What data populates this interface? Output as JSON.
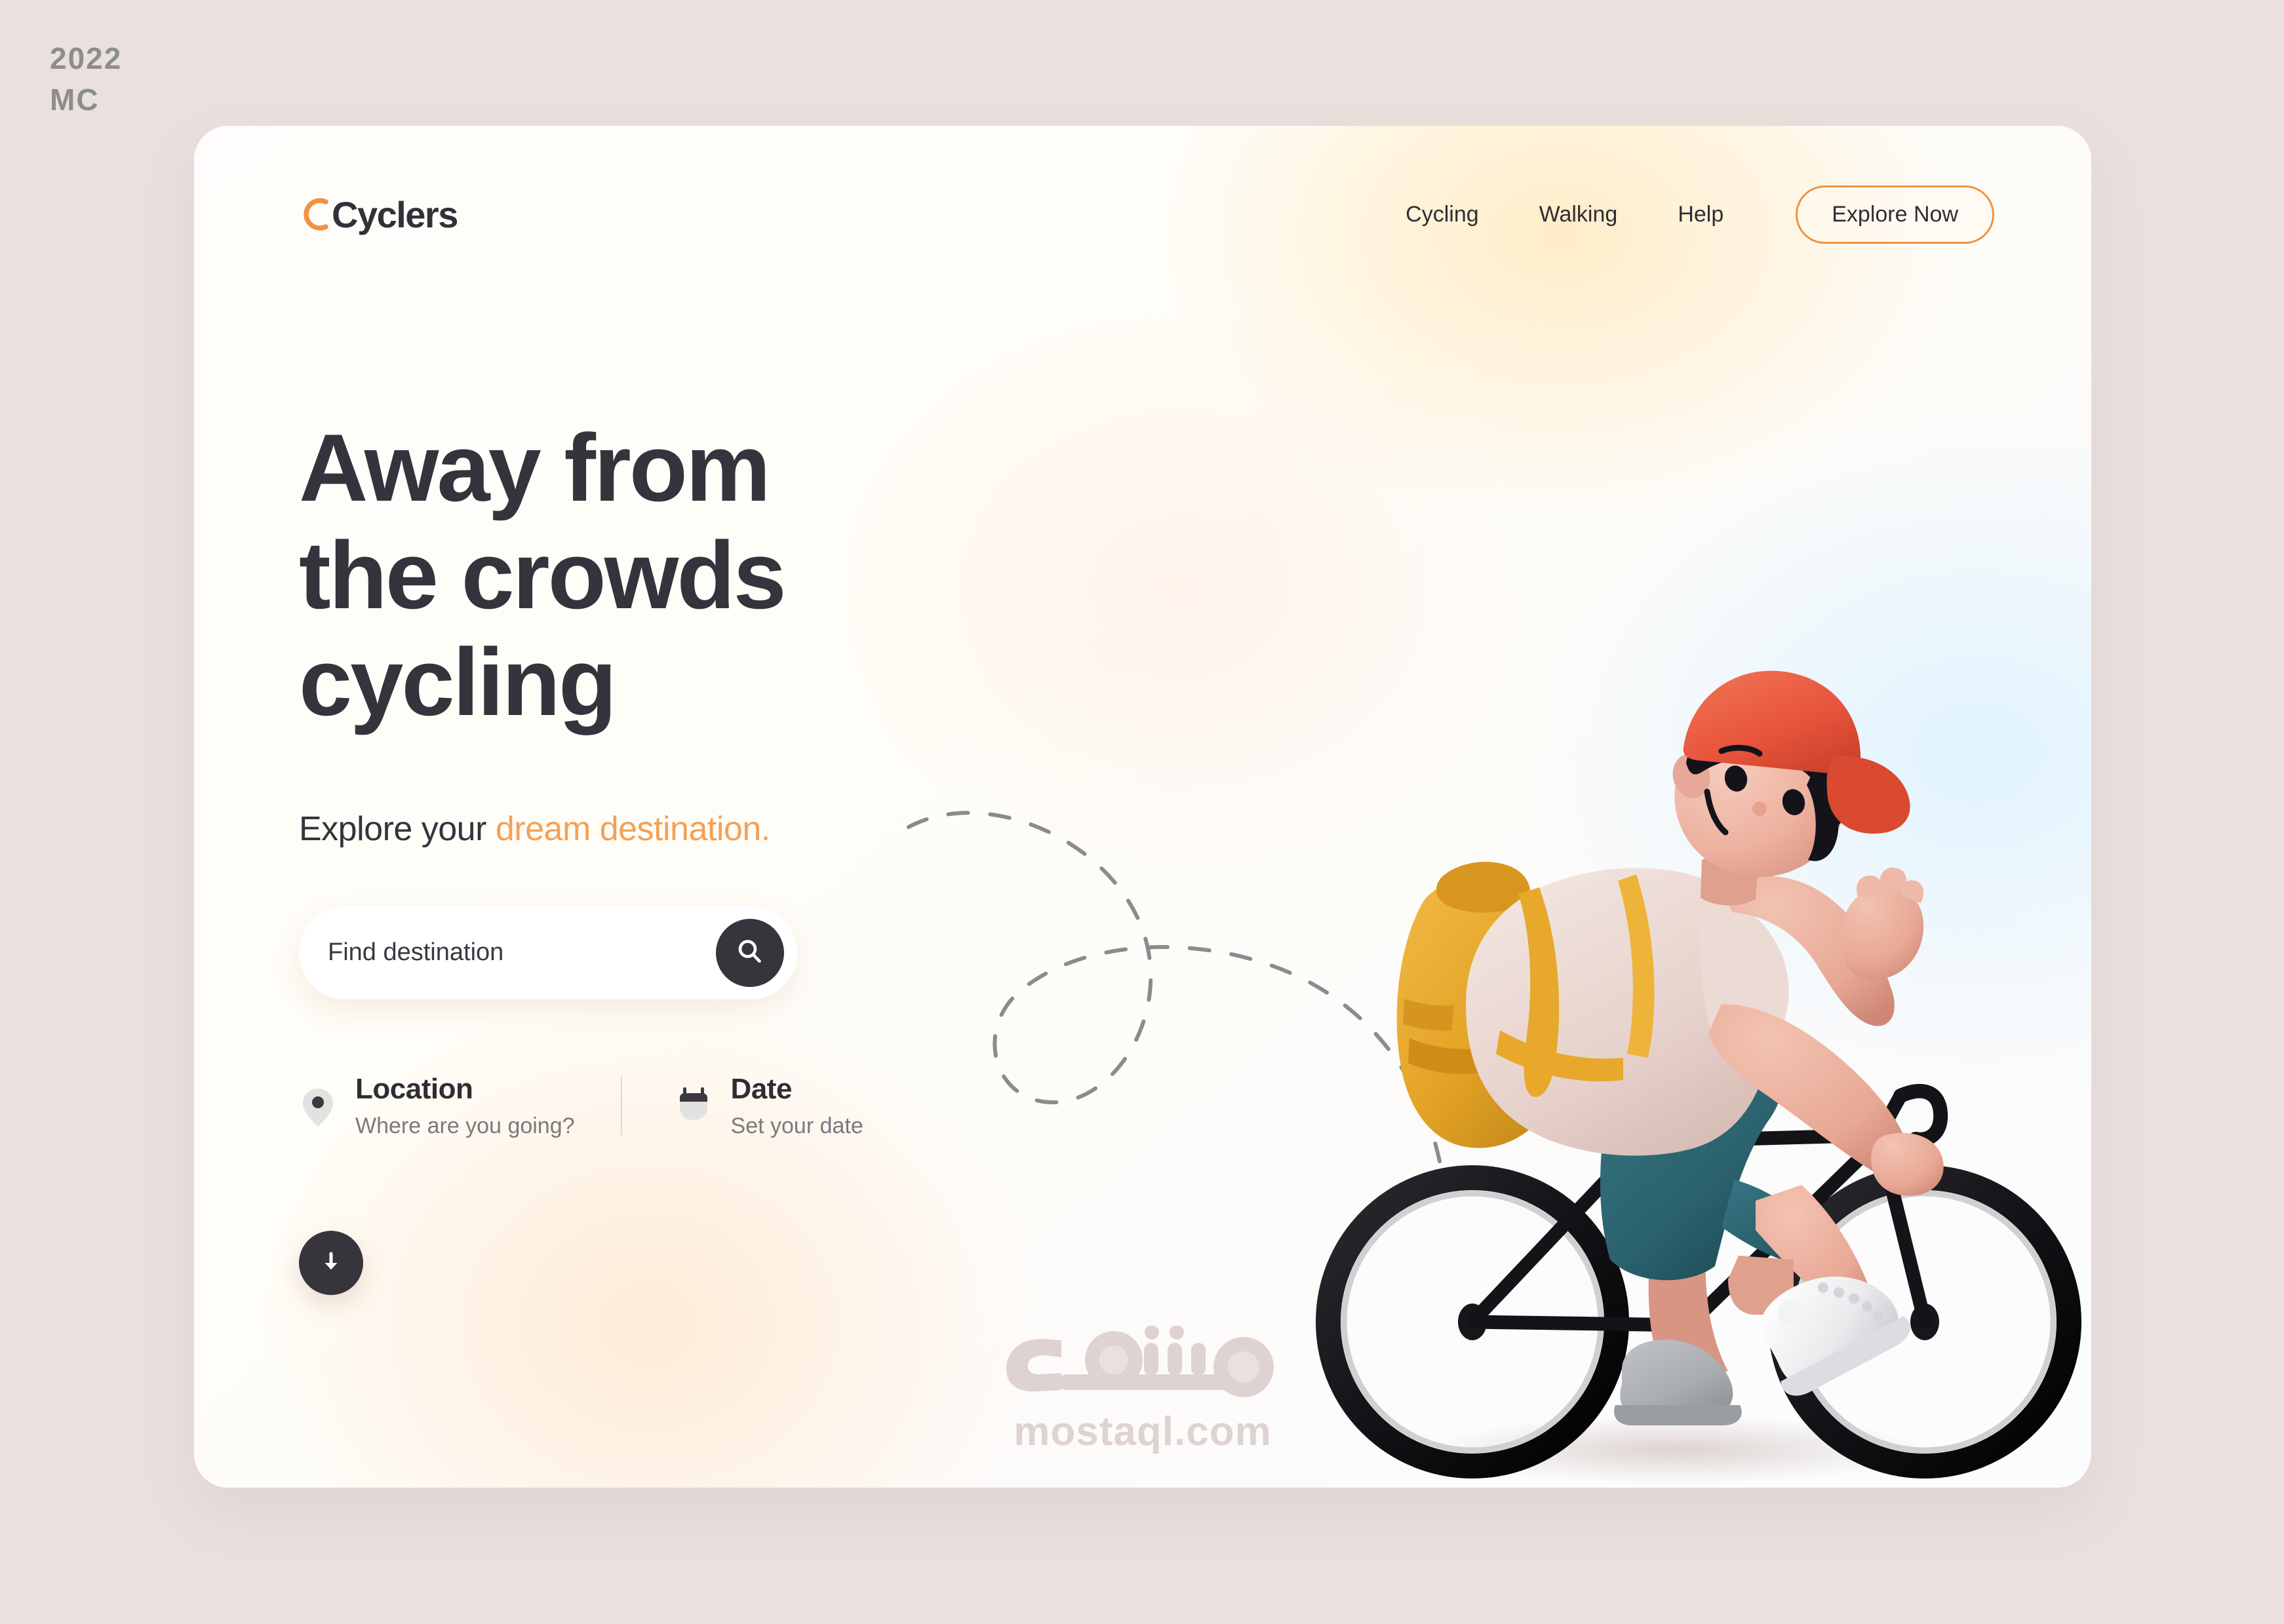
{
  "stamp": {
    "line1": "2022",
    "line2": "MC"
  },
  "brand": {
    "name": "Cyclers",
    "arc_color": "#f0933f",
    "text_color": "#333138"
  },
  "nav": {
    "items": [
      {
        "label": "Cycling"
      },
      {
        "label": "Walking"
      },
      {
        "label": "Help"
      }
    ],
    "cta_label": "Explore Now",
    "cta_border_color": "#f0933f"
  },
  "hero": {
    "headline_lines": [
      "Away from",
      "the crowds",
      "cycling"
    ],
    "subtitle_plain": "Explore your ",
    "subtitle_accent": "dream destination.",
    "accent_color": "#f3a157",
    "heading_color": "#35333b"
  },
  "search": {
    "placeholder": "Find destination",
    "value": "",
    "icon": "search-icon",
    "button_color": "#37353c"
  },
  "meta": [
    {
      "icon": "map-pin-icon",
      "title": "Location",
      "subtitle": "Where are you going?"
    },
    {
      "icon": "calendar-icon",
      "title": "Date",
      "subtitle": "Set your date"
    }
  ],
  "scroll": {
    "icon": "arrow-down-icon",
    "color": "#37353c"
  },
  "illustration": {
    "name": "cyclist-3d-illustration",
    "cap_color": "#e8553c",
    "hair_color": "#15131a",
    "skin_color": "#edb19f",
    "shirt_color": "#e9d5cf",
    "backpack_color": "#e8a52c",
    "shorts_color": "#2a626d",
    "shoe_color": "#e9eaec",
    "bike_color": "#141318"
  },
  "path": {
    "name": "dashed-route-path",
    "color": "#8c8a8c"
  },
  "watermark": {
    "arabic": "مستقل",
    "domain": "mostaql.com",
    "color": "#ded3d1"
  },
  "background": {
    "page": "#eae1df",
    "card": "#fefdfb"
  }
}
